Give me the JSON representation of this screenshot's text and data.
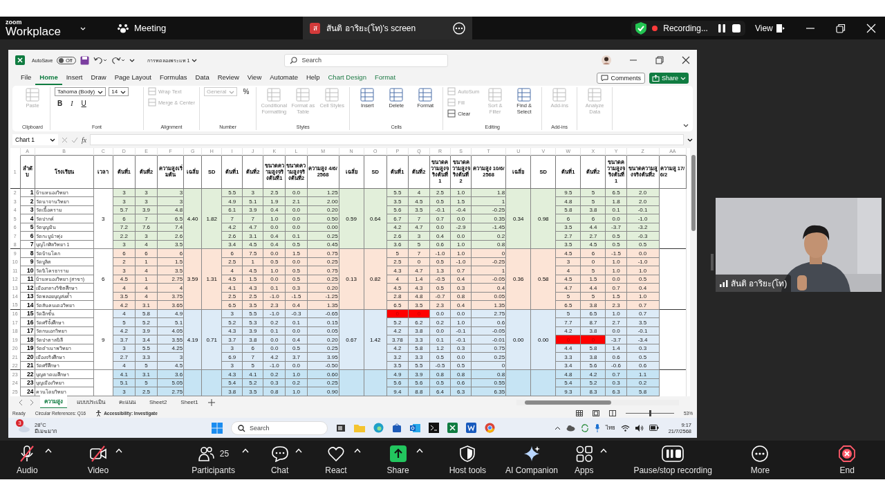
{
  "zoom_top_bar": {
    "brand_small": "zoom",
    "brand": "Workplace",
    "meeting": "Meeting",
    "share_avatar": "ส",
    "share_title": "สันติ อาริยะ(โท)'s screen",
    "recording": "Recording...",
    "view": "View"
  },
  "excel": {
    "autosave": "AutoSave",
    "autosave_on": false,
    "autosave_state": "Off",
    "file_name": "การทดลองพระแท 1",
    "search_placeholder": "Search",
    "ribbon_tabs": [
      {
        "label": "File",
        "selected": false,
        "contextual": false
      },
      {
        "label": "Home",
        "selected": true,
        "contextual": false
      },
      {
        "label": "Insert",
        "selected": false,
        "contextual": false
      },
      {
        "label": "Draw",
        "selected": false,
        "contextual": false
      },
      {
        "label": "Page Layout",
        "selected": false,
        "contextual": false
      },
      {
        "label": "Formulas",
        "selected": false,
        "contextual": false
      },
      {
        "label": "Data",
        "selected": false,
        "contextual": false
      },
      {
        "label": "Review",
        "selected": false,
        "contextual": false
      },
      {
        "label": "View",
        "selected": false,
        "contextual": false
      },
      {
        "label": "Automate",
        "selected": false,
        "contextual": false
      },
      {
        "label": "Help",
        "selected": false,
        "contextual": false
      },
      {
        "label": "Chart Design",
        "selected": false,
        "contextual": true
      },
      {
        "label": "Format",
        "selected": false,
        "contextual": true
      }
    ],
    "comments": "Comments",
    "share": "Share",
    "ribbon_groups": [
      {
        "label": "Clipboard",
        "items": [
          {
            "kind": "large",
            "label": "Paste",
            "disabled": true
          }
        ]
      },
      {
        "label": "Font",
        "items": [
          {
            "kind": "dropdown",
            "label": "Tahoma (Body)",
            "disabled": false
          },
          {
            "kind": "dropdown",
            "label": "14",
            "disabled": false
          },
          {
            "kind": "bold",
            "label": "B",
            "disabled": false
          },
          {
            "kind": "italic",
            "label": "I",
            "disabled": false
          },
          {
            "kind": "underline",
            "label": "U",
            "disabled": false
          }
        ]
      },
      {
        "label": "Alignment",
        "items": [
          {
            "kind": "small",
            "label": "Wrap Text",
            "disabled": true
          },
          {
            "kind": "small",
            "label": "Merge & Center",
            "disabled": true
          }
        ]
      },
      {
        "label": "Number",
        "items": [
          {
            "kind": "dropdown",
            "label": "General",
            "disabled": true
          },
          {
            "kind": "symbol",
            "label": "%",
            "disabled": false
          }
        ]
      },
      {
        "label": "Styles",
        "items": [
          {
            "kind": "large",
            "label": "Conditional Formatting",
            "disabled": true
          },
          {
            "kind": "large",
            "label": "Format as Table",
            "disabled": true
          },
          {
            "kind": "large",
            "label": "Cell Styles",
            "disabled": true
          }
        ]
      },
      {
        "label": "Cells",
        "items": [
          {
            "kind": "large",
            "label": "Insert",
            "disabled": false
          },
          {
            "kind": "large",
            "label": "Delete",
            "disabled": false
          },
          {
            "kind": "large",
            "label": "Format",
            "disabled": false
          }
        ]
      },
      {
        "label": "Editing",
        "items": [
          {
            "kind": "small",
            "label": "AutoSum",
            "disabled": true
          },
          {
            "kind": "small",
            "label": "Fill",
            "disabled": true
          },
          {
            "kind": "small",
            "label": "Clear",
            "disabled": false
          },
          {
            "kind": "large",
            "label": "Sort & Filter",
            "disabled": true
          },
          {
            "kind": "large",
            "label": "Find & Select",
            "disabled": false
          }
        ]
      },
      {
        "label": "Add-ins",
        "items": [
          {
            "kind": "large",
            "label": "Add-ins",
            "disabled": true
          }
        ]
      },
      {
        "items": [
          {
            "kind": "large",
            "label": "Analyze Data",
            "disabled": true
          }
        ]
      }
    ],
    "name_box": "Chart 1",
    "fx": "fx",
    "sheet": {
      "column_letters": [
        "A",
        "B",
        "C",
        "D",
        "E",
        "F",
        "G",
        "H",
        "I",
        "J",
        "K",
        "L",
        "M",
        "N",
        "O",
        "P",
        "Q",
        "R",
        "S",
        "T",
        "U",
        "V",
        "W",
        "X",
        "Y",
        "Z",
        "AA"
      ],
      "header_row_number": "1",
      "headers": [
        "ลำดับ",
        "โรงเรียน",
        "เวลา",
        "ต้นที่1",
        "ต้นที่2",
        "ความสูงเริ่มต้น",
        "เฉลี่ย",
        "SD",
        "ต้นที่1",
        "ต้นที่2",
        "ขนาดความสูงจริงต้นที่1",
        "ขนาดความสูงจริงต้นที่2",
        "ความสูง 4/6/2568",
        "เฉลี่ย",
        "SD",
        "ต้นที่1",
        "ต้นที่2",
        "ขนาดความสูงจริงต้นที่1",
        "ขนาดความสูงจริงต้นที่2",
        "ความสูง 10/6/2568",
        "เฉลี่ย",
        "SD",
        "ต้นที่1",
        "ต้นที่2",
        "ขนาดความสูงจริงต้นที่1",
        "ขนาดความสูงจริงต้นที่2",
        "ความสู 17/6/2"
      ],
      "groups": [
        {
          "color": "#e2efda",
          "time": "3",
          "stats": [
            "4.40",
            "1.82",
            "0.59",
            "0.64",
            "0.34",
            "0.98"
          ],
          "rows": [
            {
              "row_number": "2",
              "index": "1",
              "school": "บ้านหนองวิทยา",
              "values": [
                "3",
                "3",
                "3",
                "5.5",
                "3",
                "2.5",
                "0.0",
                "1.25",
                "5.5",
                "4",
                "2.5",
                "1.0",
                "1.8",
                "9.5",
                "5",
                "6.5",
                "2.0"
              ]
            },
            {
              "row_number": "3",
              "index": "2",
              "school": "วัดนาจานวิทยา",
              "values": [
                "3",
                "3",
                "3",
                "4.9",
                "5.1",
                "1.9",
                "2.1",
                "2.00",
                "3.5",
                "4.5",
                "0.5",
                "1.5",
                "1",
                "4.8",
                "5",
                "1.8",
                "2.0"
              ]
            },
            {
              "row_number": "4",
              "index": "3",
              "school": "วัดเนื้อคราม",
              "values": [
                "5.7",
                "3.9",
                "4.8",
                "6.1",
                "3.9",
                "0.4",
                "0.0",
                "0.20",
                "5.6",
                "3.5",
                "-0.1",
                "-0.4",
                "-0.25",
                "5.8",
                "3.8",
                "0.1",
                "-0.1"
              ]
            },
            {
              "row_number": "5",
              "index": "4",
              "school": "วัดปากค์",
              "values": [
                "6",
                "7",
                "6.5",
                "7",
                "7",
                "1.0",
                "0.0",
                "0.50",
                "6.7",
                "7",
                "0.7",
                "0.0",
                "0.35",
                "6",
                "6",
                "0.0",
                "-1.0"
              ]
            },
            {
              "row_number": "6",
              "index": "5",
              "school": "วัดบุญมิน",
              "values": [
                "7.2",
                "7.6",
                "7.4",
                "4.2",
                "4.7",
                "0.0",
                "0.0",
                "0.00",
                "4.2",
                "4.7",
                "0.0",
                "-2.9",
                "-1.45",
                "3.5",
                "4.4",
                "-3.7",
                "-3.2"
              ]
            },
            {
              "row_number": "7",
              "index": "6",
              "school": "วัดกะบูนำทุ่ง",
              "values": [
                "2.2",
                "3",
                "2.6",
                "2.6",
                "3.1",
                "0.4",
                "0.1",
                "0.25",
                "2.6",
                "3",
                "0.4",
                "0.0",
                "0.2",
                "2.7",
                "2.7",
                "0.5",
                "-0.3"
              ]
            },
            {
              "row_number": "8",
              "index": "7",
              "school": "บุญไกศิลวิทยา 1",
              "values": [
                "3",
                "4",
                "3.5",
                "3.4",
                "4.5",
                "0.4",
                "0.5",
                "0.45",
                "3.6",
                "5",
                "0.6",
                "1.0",
                "0.8",
                "3.5",
                "4.5",
                "0.5",
                "0.5"
              ]
            }
          ]
        },
        {
          "color": "#fce4d6",
          "time": "6",
          "stats": [
            "3.59",
            "1.31",
            "0.13",
            "0.82",
            "0.36",
            "0.58"
          ],
          "rows": [
            {
              "row_number": "9",
              "index": "8",
              "school": "วัดบ้านโคก",
              "values": [
                "6",
                "6",
                "6",
                "6",
                "7.5",
                "0.0",
                "1.5",
                "0.75",
                "5",
                "7",
                "-1.0",
                "1.0",
                "0",
                "4.5",
                "6",
                "-1.5",
                "0.0"
              ]
            },
            {
              "row_number": "10",
              "index": "9",
              "school": "วัดบูลิต",
              "values": [
                "2",
                "1",
                "1.5",
                "2.5",
                "1",
                "0.5",
                "0.0",
                "0.25",
                "2.5",
                "0",
                "0.5",
                "-1.0",
                "-0.25",
                "3",
                "0",
                "1.0",
                "-1.0"
              ]
            },
            {
              "row_number": "11",
              "index": "10",
              "school": "วัดนิโครธาราม",
              "values": [
                "3",
                "4",
                "3.5",
                "4",
                "4.5",
                "1.0",
                "0.5",
                "0.75",
                "4.3",
                "4.7",
                "1.3",
                "0.7",
                "1",
                "4",
                "5",
                "1.0",
                "1.0"
              ]
            },
            {
              "row_number": "12",
              "index": "11",
              "school": "บ้านหนองวิทยา (สาขา)",
              "values": [
                "4.5",
                "1",
                "2.75",
                "4.5",
                "1.5",
                "0.0",
                "0.5",
                "0.25",
                "4",
                "1.4",
                "-0.5",
                "0.4",
                "-0.05",
                "4.5",
                "1.5",
                "0.0",
                "0.5"
              ]
            },
            {
              "row_number": "13",
              "index": "12",
              "school": "เมืองกลางวิชิตศึกษา",
              "values": [
                "4",
                "4",
                "4",
                "4.1",
                "4.3",
                "0.1",
                "0.3",
                "0.20",
                "4.5",
                "4.3",
                "0.5",
                "0.3",
                "0.4",
                "4.7",
                "4.4",
                "0.7",
                "0.4"
              ]
            },
            {
              "row_number": "14",
              "index": "13",
              "school": "วัดพลอยบุญส่งค้ำ",
              "values": [
                "3.5",
                "4",
                "3.75",
                "2.5",
                "2.5",
                "-1.0",
                "-1.5",
                "-1.25",
                "2.8",
                "4.8",
                "-0.7",
                "0.8",
                "0.05",
                "5",
                "5",
                "1.5",
                "1.0"
              ]
            },
            {
              "row_number": "15",
              "index": "14",
              "school": "วัดสันคนเดอวิทยา",
              "values": [
                "4.2",
                "3.1",
                "3.65",
                "6.5",
                "3.5",
                "2.3",
                "0.4",
                "1.35",
                "6.5",
                "3.5",
                "2.3",
                "0.4",
                "1.35",
                "6.5",
                "3.8",
                "2.3",
                "0.7"
              ]
            }
          ]
        },
        {
          "color": "#ddebf7",
          "time": "9",
          "stats": [
            "4.19",
            "0.71",
            "0.67",
            "1.42",
            "0.00",
            "0.00"
          ],
          "rows": [
            {
              "row_number": "16",
              "index": "15",
              "school": "วัดอีกขั้น",
              "values": [
                "4",
                "5.8",
                "4.9",
                "3",
                "5.5",
                "-1.0",
                "-0.3",
                "-0.65",
                {
                  "value": "0",
                  "alert": true
                },
                {
                  "value": "0",
                  "alert": true
                },
                "0.0",
                "0.0",
                "2.75",
                "5",
                "6.5",
                "1.0",
                "0.7"
              ]
            },
            {
              "row_number": "17",
              "index": "16",
              "school": "วัดศรีจั้งศึกษา",
              "values": [
                "5",
                "5.2",
                "5.1",
                "5.2",
                "5.3",
                "0.2",
                "0.1",
                "0.15",
                "5.2",
                "6.2",
                "0.2",
                "1.0",
                "0.6",
                "7.7",
                "8.7",
                "2.7",
                "3.5"
              ]
            },
            {
              "row_number": "18",
              "index": "17",
              "school": "วัดกนเอกวิทยา",
              "values": [
                "4.2",
                "3.9",
                "4.05",
                "4.3",
                "3.9",
                "0.1",
                "0.0",
                "0.05",
                "4.2",
                "3.8",
                "0.0",
                "-0.1",
                "-0.05",
                "4.2",
                "3.8",
                "0.0",
                "-0.1"
              ]
            },
            {
              "row_number": "19",
              "index": "18",
              "school": "วัดป่าตาลนิลี",
              "values": [
                "3.7",
                "3.4",
                "3.55",
                "3.7",
                "3.8",
                "0.0",
                "0.4",
                "0.20",
                "3.78",
                "3.3",
                "0.1",
                "-0.1",
                "-0.01",
                {
                  "value": "0",
                  "alert": true
                },
                {
                  "value": "0",
                  "alert": true
                },
                "-3.7",
                "-3.4"
              ]
            },
            {
              "row_number": "20",
              "index": "19",
              "school": "วัดดำเนาพวิทยา",
              "values": [
                "3",
                "5.5",
                "4.25",
                "3",
                "6",
                "0.0",
                "0.5",
                "0.25",
                "4.2",
                "5.8",
                "1.2",
                "0.3",
                "0.75",
                "4.4",
                "5.8",
                "1.4",
                "0.3"
              ]
            },
            {
              "row_number": "21",
              "index": "20",
              "school": "เมืองจริงศึกษา",
              "values": [
                "2.7",
                "3.3",
                "3",
                "6.9",
                "7",
                "4.2",
                "3.7",
                "3.95",
                "3.2",
                "3.3",
                "0.5",
                "0.0",
                "0.25",
                "3.3",
                "3.8",
                "0.6",
                "0.5"
              ]
            },
            {
              "row_number": "22",
              "index": "21",
              "school": "วัดศรีศึกษา",
              "values": [
                "4",
                "5",
                "4.5",
                "3",
                "5",
                "-1.0",
                "0.0",
                "-0.50",
                "3.5",
                "5.5",
                "-0.5",
                "0.5",
                "0",
                "3.4",
                "5.6",
                "-0.6",
                "0.6"
              ]
            }
          ]
        },
        {
          "color": "#c6e4f4",
          "rows": [
            {
              "row_number": "23",
              "index": "22",
              "school": "บุญตาดเมศึกษา",
              "values": [
                "4.1",
                "3.1",
                "3.6",
                "4.3",
                "4.1",
                "0.2",
                "1.0",
                "0.60",
                "4.9",
                "3.9",
                "0.8",
                "0.8",
                "0.8",
                "4.8",
                "4.2",
                "0.7",
                "1.1"
              ]
            },
            {
              "row_number": "24",
              "index": "23",
              "school": "บุญเมืองวิทยา",
              "values": [
                "5.1",
                "5",
                "5.05",
                "5.4",
                "5.2",
                "0.3",
                "0.2",
                "0.25",
                "5.6",
                "5.6",
                "0.5",
                "0.6",
                "0.55",
                "5.4",
                "5.2",
                "0.3",
                "0.2"
              ]
            },
            {
              "row_number": "25",
              "index": "24",
              "school": "ควนโดยวิทยา",
              "values": [
                "3",
                "2.5",
                "2.75",
                "3.8",
                "3.5",
                "0.8",
                "1.0",
                "0.90",
                "9.4",
                "8.8",
                "6.4",
                "6.3",
                "6.35",
                "9.3",
                "8.3",
                "6.3",
                "5.8"
              ]
            }
          ]
        }
      ]
    },
    "sheet_tabs": [
      {
        "label": "ความสูง",
        "selected": true
      },
      {
        "label": "แบบประเมิน",
        "selected": false
      },
      {
        "label": "คะแนน",
        "selected": false
      },
      {
        "label": "Sheet2",
        "selected": false
      },
      {
        "label": "Sheet1",
        "selected": false
      }
    ],
    "status_bar": {
      "ready": "Ready",
      "circular": "Circular References: Q16",
      "accessibility": "Accessibility: Investigate",
      "zoom": "53%",
      "zoom_slider": {
        "level": 0.5
      }
    }
  },
  "taskbar": {
    "weather_badge": "3",
    "temperature": "28°C",
    "weather": "มีเมฆมาก",
    "search_placeholder": "Search",
    "language": "ไทย",
    "time": "9:17",
    "date": "21/7/2568"
  },
  "video_tile": {
    "name": "สันติ อาริยะ(โท)"
  },
  "toolbar": [
    {
      "kind": "audio",
      "label": "Audio",
      "muted": true,
      "caret": true
    },
    {
      "kind": "video",
      "label": "Video",
      "muted": true,
      "caret": true
    },
    {
      "kind": "participants",
      "label": "Participants",
      "count": "25",
      "caret": true
    },
    {
      "kind": "chat",
      "label": "Chat",
      "caret": true
    },
    {
      "kind": "react",
      "label": "React",
      "caret": true
    },
    {
      "kind": "share",
      "label": "Share",
      "caret": true
    },
    {
      "kind": "host",
      "label": "Host tools",
      "caret": false
    },
    {
      "kind": "ai",
      "label": "AI Companion",
      "caret": false
    },
    {
      "kind": "apps",
      "label": "Apps",
      "caret": true
    },
    {
      "kind": "recording",
      "label": "Pause/stop recording",
      "caret": false
    },
    {
      "kind": "more",
      "label": "More",
      "caret": false
    },
    {
      "kind": "end",
      "label": "End",
      "caret": false
    }
  ]
}
